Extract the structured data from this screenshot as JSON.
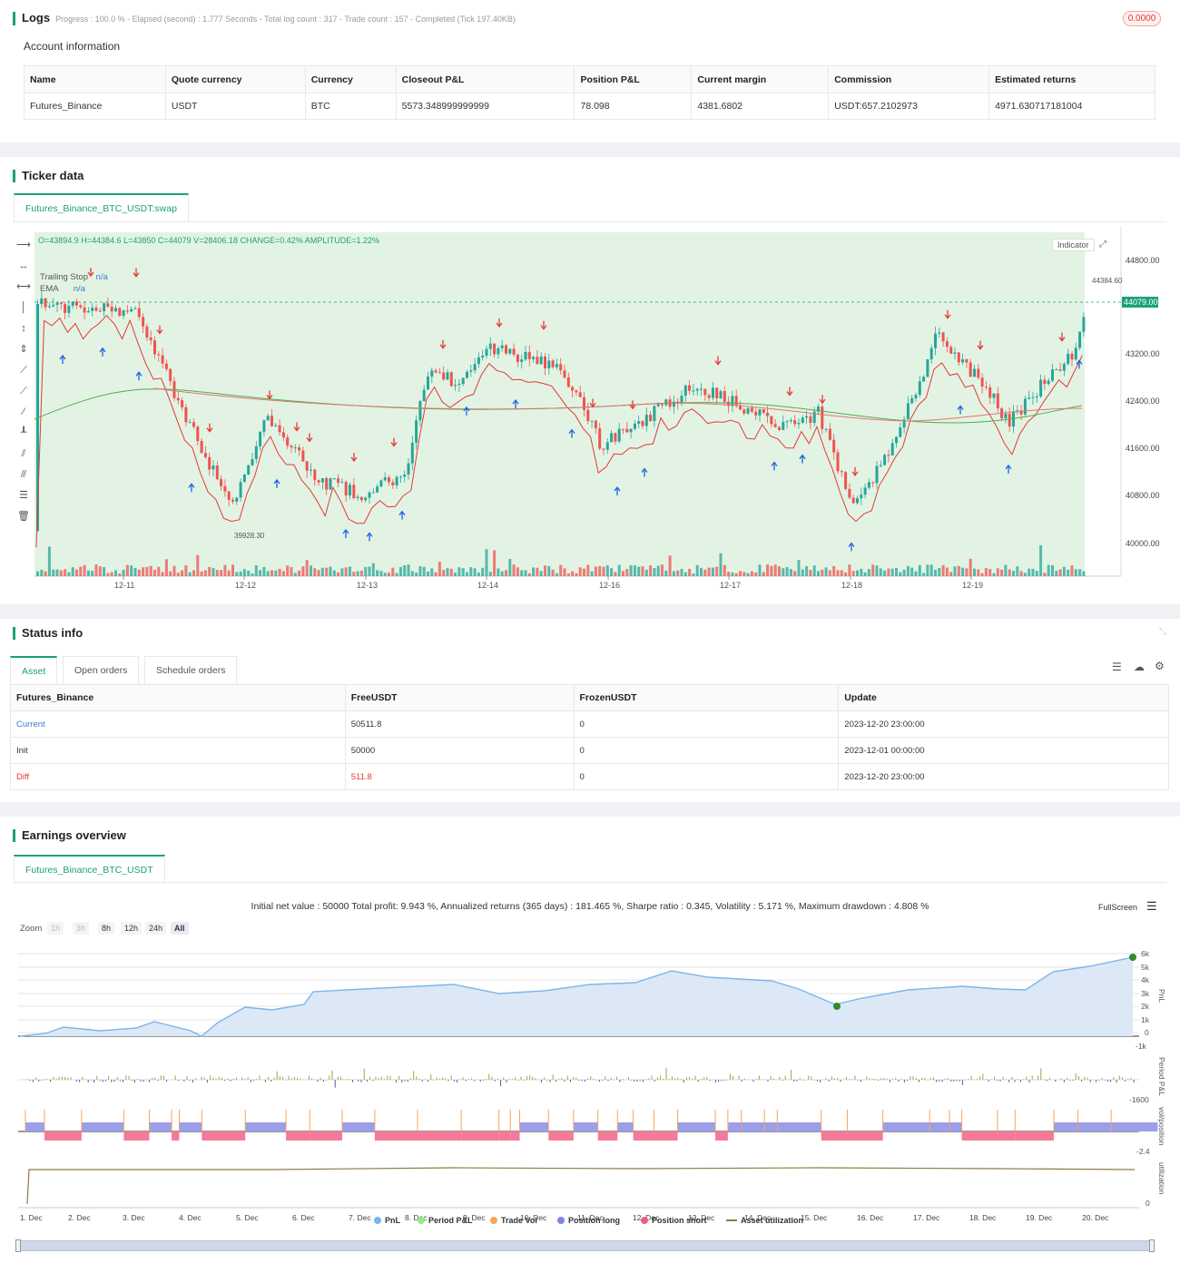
{
  "logs": {
    "title": "Logs",
    "progress": "Progress : 100.0 % - Elapsed (second) : 1.777  Seconds - Total log count : 317 - Trade count : 157 - Completed (Tick 197.40KB)",
    "badge": "0.0000"
  },
  "account": {
    "title": "Account information",
    "headers": [
      "Name",
      "Quote currency",
      "Currency",
      "Closeout P&L",
      "Position P&L",
      "Current margin",
      "Commission",
      "Estimated returns"
    ],
    "row": [
      "Futures_Binance",
      "USDT",
      "BTC",
      "5573.348999999999",
      "78.098",
      "4381.6802",
      "USDT:657.2102973",
      "4971.630717181004"
    ]
  },
  "ticker": {
    "title": "Ticker data",
    "tab": "Futures_Binance_BTC_USDT:swap",
    "ohlc": "O=43894.9 H=44384.6 L=43850 C=44079 V=28406.18 CHANGE=0.42% AMPLITUDE=1.22%",
    "legend": [
      {
        "name": "Trailing Stop",
        "value": "n/a"
      },
      {
        "name": "EMA",
        "value": "n/a"
      }
    ],
    "indicator_btn": "Indicator",
    "price_ticks": [
      "44800.00",
      "43200.00",
      "42400.00",
      "41600.00",
      "40800.00",
      "40000.00"
    ],
    "last_price": "44079.00",
    "high_label": "44384.60",
    "low_label": "39928.30",
    "date_ticks": [
      "12-11",
      "12-12",
      "12-13",
      "12-14",
      "12-16",
      "12-17",
      "12-18",
      "12-19"
    ]
  },
  "status": {
    "title": "Status info",
    "tabs": [
      "Asset",
      "Open orders",
      "Schedule orders"
    ],
    "headers": [
      "Futures_Binance",
      "FreeUSDT",
      "FrozenUSDT",
      "Update"
    ],
    "rows": [
      [
        "Current",
        "50511.8",
        "0",
        "2023-12-20 23:00:00"
      ],
      [
        "Init",
        "50000",
        "0",
        "2023-12-01 00:00:00"
      ],
      [
        "Diff",
        "511.8",
        "0",
        "2023-12-20 23:00:00"
      ]
    ],
    "colors": {
      "current": "#3a7bd5",
      "diff": "#e53935"
    }
  },
  "earnings": {
    "title": "Earnings overview",
    "tab": "Futures_Binance_BTC_USDT",
    "summary": "Initial net value : 50000 Total profit: 9.943 %, Annualized returns (365 days) : 181.465 %, Sharpe ratio : 0.345, Volatility : 5.171 %, Maximum drawdown : 4.808 %",
    "fullscreen": "FullScreen",
    "zoom_label": "Zoom",
    "zoom": [
      "1h",
      "3h",
      "8h",
      "12h",
      "24h",
      "All"
    ],
    "pnl_ticks": [
      "6k",
      "5k",
      "4k",
      "3k",
      "2k",
      "1k",
      "0",
      "-1k"
    ],
    "period_tick": "-1600",
    "pos_tick": "-2.4",
    "util_tick": "0",
    "axis_titles": [
      "PnL",
      "Period P&L",
      "vol/position",
      "utilization"
    ],
    "dates": [
      "1. Dec",
      "2. Dec",
      "3. Dec",
      "4. Dec",
      "5. Dec",
      "6. Dec",
      "7. Dec",
      "8. Dec",
      "9. Dec",
      "10. Dec",
      "11. Dec",
      "12. Dec",
      "13. Dec",
      "14. Dec",
      "15. Dec",
      "16. Dec",
      "17. Dec",
      "18. Dec",
      "19. Dec",
      "20. Dec"
    ],
    "legend": [
      {
        "name": "PnL",
        "color": "#7cb5ec"
      },
      {
        "name": "Period P&L",
        "color": "#90ed7d"
      },
      {
        "name": "Trade Vol",
        "color": "#f7a35c"
      },
      {
        "name": "Position long",
        "color": "#8085e9"
      },
      {
        "name": "Position short",
        "color": "#f15c80"
      },
      {
        "name": "Asset utilization",
        "color": "#8d7b3e"
      }
    ]
  }
}
